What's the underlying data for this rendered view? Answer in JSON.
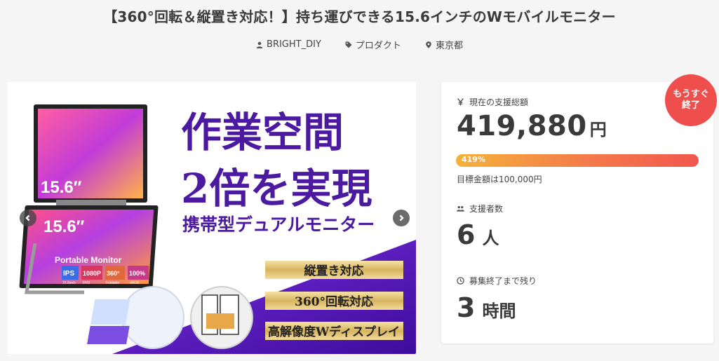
{
  "project": {
    "title": "【360°回転＆縦置き対応！】持ち運びできる15.6インチのWモバイルモニター",
    "owner": "BRIGHT_DIY",
    "category": "プロダクト",
    "location": "東京都"
  },
  "hero_image": {
    "headline_1": "作業空間",
    "headline_2": "2倍を実現",
    "subheadline": "携帯型デュアルモニター",
    "screen_size_top": "15.6″",
    "screen_size_bottom": "15.6″",
    "device_label": "Portable Monitor",
    "spec_badges": [
      "IPS",
      "1080P",
      "360°",
      "100%"
    ],
    "spec_captions": [
      "15.6inch",
      "FHD",
      "Foldable",
      "sRGB"
    ],
    "feature_1": "縦置き対応",
    "feature_2": "360°回転対応",
    "feature_3": "高解像度Wディスプレイ"
  },
  "funding": {
    "amount_label": "現在の支援総額",
    "amount": "419,880",
    "amount_unit": "円",
    "progress_text": "419%",
    "progress_percent": 419,
    "goal_text": "目標金額は100,000円",
    "backers_label": "支援者数",
    "backers": "6",
    "backers_unit": "人",
    "remaining_label": "募集終了まで残り",
    "remaining": "3",
    "remaining_unit": "時間",
    "badge_line1": "もうすぐ",
    "badge_line2": "終了"
  },
  "colors": {
    "accent_red": "#ef4f4c",
    "progress_start": "#f5b23a",
    "progress_end": "#f2574f",
    "purple": "#5a1fb0"
  },
  "icons": [
    "user-icon",
    "tag-icon",
    "location-pin-icon",
    "yen-icon",
    "group-icon",
    "clock-icon",
    "chevron-left-icon",
    "chevron-right-icon"
  ]
}
